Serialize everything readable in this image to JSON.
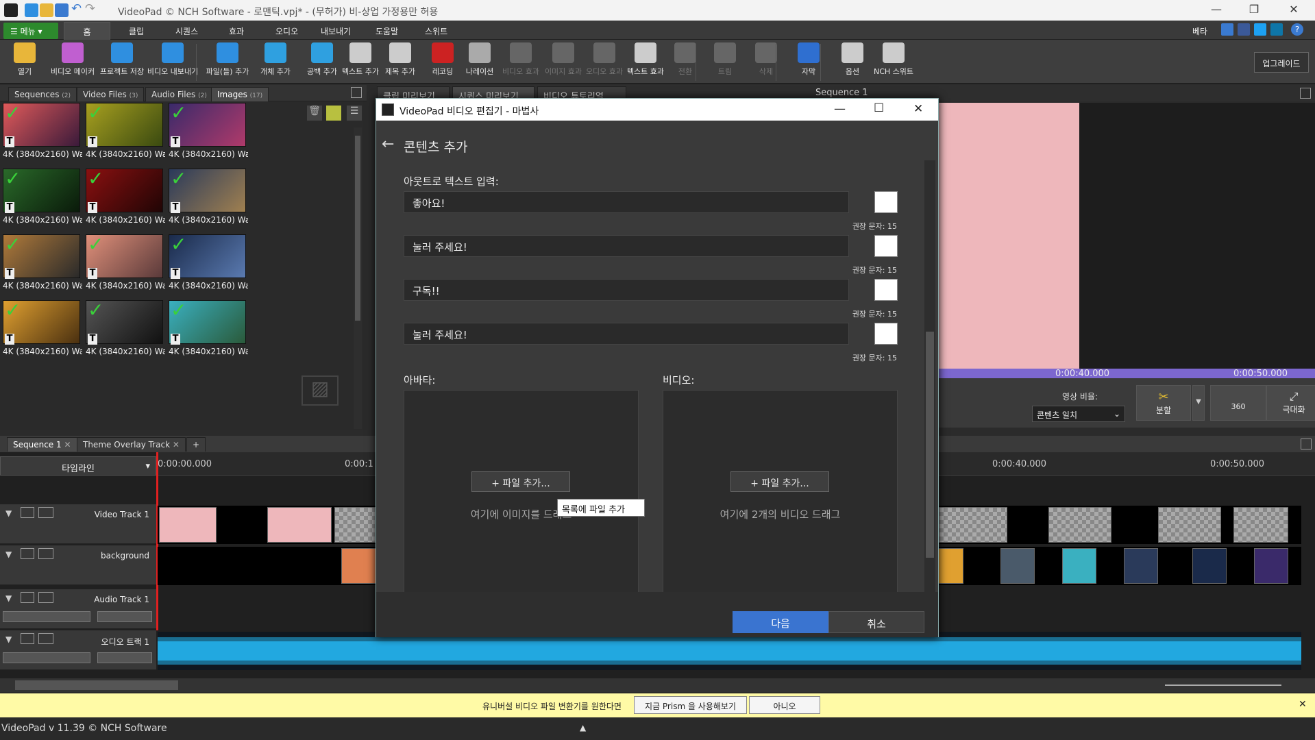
{
  "window": {
    "title": "VideoPad © NCH Software - 로맨틱.vpj* - (무허가) 비-상업 가정용만 허용",
    "controls": {
      "minimize": "—",
      "maximize": "❐",
      "close": "✕"
    }
  },
  "menu": {
    "button": "메뉴",
    "tabs": [
      "홈",
      "클립",
      "시퀀스",
      "효과",
      "오디오",
      "내보내기",
      "도움말",
      "스위트"
    ],
    "right_label": "베타"
  },
  "ribbon": {
    "buttons": [
      {
        "label": "열기",
        "icon": "folder-open-icon",
        "color": "#e8b63a"
      },
      {
        "label": "비디오 메이커",
        "icon": "wizard-icon",
        "color": "#c05fd0"
      },
      {
        "label": "프로젝트 저장",
        "icon": "save-icon",
        "color": "#2f8fe0"
      },
      {
        "label": "비디오 내보내기",
        "icon": "export-icon",
        "color": "#2f8fe0"
      },
      {
        "label": "파일(들) 추가",
        "icon": "add-file-icon",
        "color": "#2f8fe0"
      },
      {
        "label": "개체 추가",
        "icon": "add-object-icon",
        "color": "#2fa0e0"
      },
      {
        "label": "공백 추가",
        "icon": "add-blank-icon",
        "color": "#2fa0e0"
      },
      {
        "label": "텍스트 추가",
        "icon": "add-text-icon",
        "color": "#cccccc"
      },
      {
        "label": "제목 추가",
        "icon": "add-title-icon",
        "color": "#cccccc"
      },
      {
        "label": "레코딩",
        "icon": "record-icon",
        "color": "#cc2222"
      },
      {
        "label": "나레이션",
        "icon": "microphone-icon",
        "color": "#aaaaaa"
      },
      {
        "label": "비디오 효과",
        "icon": "video-fx-icon",
        "color": "#666666"
      },
      {
        "label": "이미지 효과",
        "icon": "image-fx-icon",
        "color": "#666666"
      },
      {
        "label": "오디오 효과",
        "icon": "audio-fx-icon",
        "color": "#666666"
      },
      {
        "label": "텍스트 효과",
        "icon": "text-fx-icon",
        "color": "#cccccc"
      },
      {
        "label": "전환",
        "icon": "transition-icon",
        "color": "#666666"
      },
      {
        "label": "트림",
        "icon": "trim-icon",
        "color": "#666666"
      },
      {
        "label": "삭제",
        "icon": "delete-icon",
        "color": "#666666"
      },
      {
        "label": "자막",
        "icon": "subtitle-icon",
        "color": "#2f6fd0"
      },
      {
        "label": "옵션",
        "icon": "options-icon",
        "color": "#cccccc"
      },
      {
        "label": "NCH 스위트",
        "icon": "nch-suite-icon",
        "color": "#cccccc"
      }
    ],
    "upgrade": "업그레이드"
  },
  "library": {
    "tabs": [
      {
        "label": "Sequences",
        "count": "(2)"
      },
      {
        "label": "Video Files",
        "count": "(3)"
      },
      {
        "label": "Audio Files",
        "count": "(2)"
      },
      {
        "label": "Images",
        "count": "(17)"
      }
    ],
    "thumbnails": [
      {
        "label": "4K (3840x2160) Wallp...",
        "color1": "#e05a5a",
        "color2": "#3a1a3a"
      },
      {
        "label": "4K (3840x2160) Wallp...",
        "color1": "#a8a020",
        "color2": "#3a4a10"
      },
      {
        "label": "4K (3840x2160) Wallp...",
        "color1": "#3a2a6a",
        "color2": "#b03a6a"
      },
      {
        "label": "4K (3840x2160) Wallp...",
        "color1": "#2a6a2a",
        "color2": "#0a1a0a"
      },
      {
        "label": "4K (3840x2160) Wallp...",
        "color1": "#8a1010",
        "color2": "#200505"
      },
      {
        "label": "4K (3840x2160) Wallp...",
        "color1": "#2a3a5a",
        "color2": "#a08050"
      },
      {
        "label": "4K (3840x2160) Wallp...",
        "color1": "#b07a3a",
        "color2": "#2a2a2a"
      },
      {
        "label": "4K (3840x2160) Wallp...",
        "color1": "#e0907a",
        "color2": "#5a3a3a"
      },
      {
        "label": "4K (3840x2160) Wallp...",
        "color1": "#1a2a4a",
        "color2": "#5a7ab0"
      },
      {
        "label": "4K (3840x2160) Wallp...",
        "color1": "#e0a030",
        "color2": "#4a3010"
      },
      {
        "label": "4K (3840x2160) Wallp...",
        "color1": "#555555",
        "color2": "#111111"
      },
      {
        "label": "4K (3840x2160) Wallp...",
        "color1": "#3ab0c0",
        "color2": "#2a5a3a"
      }
    ]
  },
  "preview_tabs": [
    "클립 미리보기",
    "시퀀스 미리보기",
    "비디오 튜토리얼"
  ],
  "preview": {
    "sequence_title": "Sequence 1",
    "times": [
      "0:00:40.000",
      "0:00:50.000"
    ],
    "aspect_label": "영상 비율:",
    "aspect_value": "콘텐츠 일치",
    "split": "분할",
    "three_sixty": "360",
    "maximize": "극대화"
  },
  "timeline": {
    "tabs": [
      "Sequence 1",
      "Theme Overlay Track"
    ],
    "add_tab": "+",
    "mode": "타임라인",
    "ruler": [
      "0:00:00.000",
      "0:00:1",
      "0:00:40.000",
      "0:00:50.000"
    ],
    "tracks": [
      {
        "name": "Video Track 1"
      },
      {
        "name": "background"
      },
      {
        "name": "Audio Track 1"
      },
      {
        "name": "오디오 트랙 1"
      }
    ]
  },
  "dialog": {
    "title": "VideoPad 비디오 편집기 - 마법사",
    "heading": "콘텐츠 추가",
    "outro_label": "아웃트로 텍스트 입력:",
    "texts": [
      "좋아요!",
      "눌러 주세요!",
      "구독!!",
      "눌러 주세요!"
    ],
    "hint": "권장 문자: 15",
    "avatar_label": "아바타:",
    "video_label": "비디오:",
    "add_file": "+ 파일 추가...",
    "tooltip": "목록에 파일 추가",
    "avatar_drop": "여기에 이미지를 드래그",
    "video_drop": "여기에 2개의 비디오 드래그",
    "next": "다음",
    "cancel": "취소"
  },
  "notification": {
    "message": "유니버설 비디오 파일 변환기를 원한다면",
    "try_button": "지금 Prism 을 사용해보기",
    "no_button": "아니오"
  },
  "status": {
    "version": "VideoPad v 11.39 © NCH Software"
  },
  "colors": {
    "accent_green": "#2d8a2d",
    "next_button": "#3a74d0",
    "check_green": "#3ad13a",
    "audio_wave": "#22a8e0",
    "scrub_bar": "#7c67cf",
    "notification_bg": "#fffaa6"
  }
}
